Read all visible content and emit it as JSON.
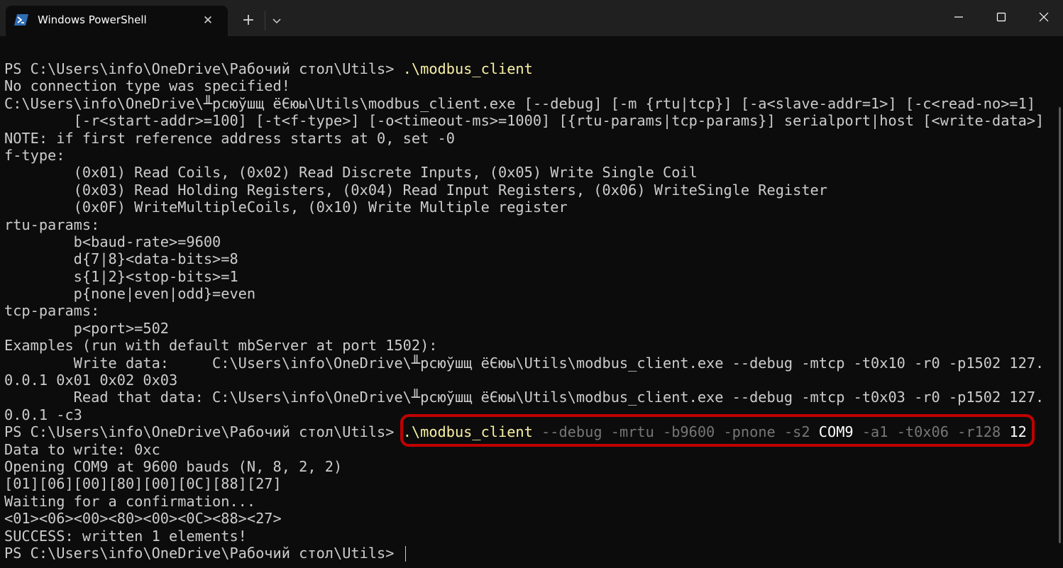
{
  "window": {
    "tab_title": "Windows PowerShell",
    "tab_close": "✕",
    "new_tab": "+",
    "icons": {
      "tab": "powershell-icon",
      "close_tab": "close-icon",
      "new_tab": "plus-icon",
      "dropdown": "chevron-down-icon",
      "minimize": "minimize-icon",
      "maximize": "maximize-icon",
      "close": "close-icon"
    }
  },
  "terminal": {
    "prompt": "PS C:\\Users\\info\\OneDrive\\Рабочий стол\\Utils> ",
    "cmd1": ".\\modbus_client",
    "output1": [
      "No connection type was specified!",
      "C:\\Users\\info\\OneDrive\\╨рсюўшщ ёЄюы\\Utils\\modbus_client.exe [--debug] [-m {rtu|tcp}] [-a<slave-addr=1>] [-c<read-no>=1]",
      "        [-r<start-addr>=100] [-t<f-type>] [-o<timeout-ms>=1000] [{rtu-params|tcp-params}] serialport|host [<write-data>]",
      "NOTE: if first reference address starts at 0, set -0",
      "f-type:",
      "        (0x01) Read Coils, (0x02) Read Discrete Inputs, (0x05) Write Single Coil",
      "        (0x03) Read Holding Registers, (0x04) Read Input Registers, (0x06) WriteSingle Register",
      "        (0x0F) WriteMultipleCoils, (0x10) Write Multiple register",
      "rtu-params:",
      "        b<baud-rate>=9600",
      "        d{7|8}<data-bits>=8",
      "        s{1|2}<stop-bits>=1",
      "        p{none|even|odd}=even",
      "tcp-params:",
      "        p<port>=502",
      "Examples (run with default mbServer at port 1502):",
      "        Write data:     C:\\Users\\info\\OneDrive\\╨рсюўшщ ёЄюы\\Utils\\modbus_client.exe --debug -mtcp -t0x10 -r0 -p1502 127.",
      "0.0.1 0x01 0x02 0x03",
      "        Read that data: C:\\Users\\info\\OneDrive\\╨рсюўшщ ёЄюы\\Utils\\modbus_client.exe --debug -mtcp -t0x03 -r0 -p1502 127.",
      "0.0.1 -c3"
    ],
    "cmd2": {
      "exe": ".\\modbus_client",
      "params1": " --debug -mrtu -b9600 -pnone -s2 ",
      "port": "COM9",
      "params2": " -a1 -t0x06 -r128 ",
      "value": "12"
    },
    "output2": [
      "Data to write: 0xc",
      "Opening COM9 at 9600 bauds (N, 8, 2, 2)",
      "[01][06][00][80][00][0C][88][27]",
      "Waiting for a confirmation...",
      "<01><06><00><80><00><0C><88><27>",
      "SUCCESS: written 1 elements!"
    ]
  },
  "colors": {
    "background": "#0c0c0c",
    "text": "#cccccc",
    "command": "#f9f1a5",
    "parameter": "#767676",
    "highlight": "#c00000"
  }
}
